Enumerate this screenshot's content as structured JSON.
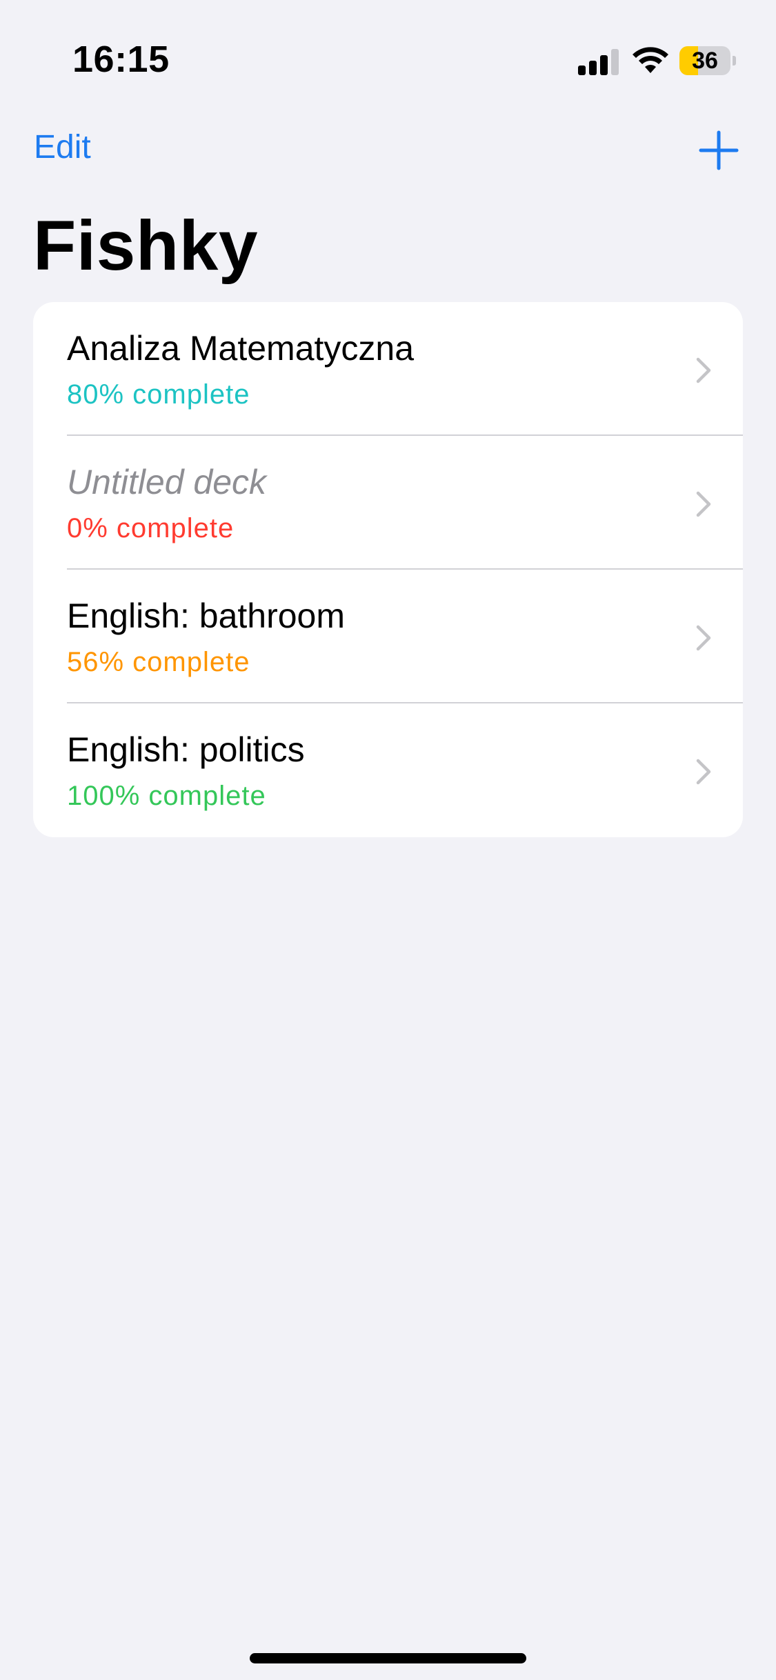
{
  "status_bar": {
    "time": "16:15",
    "battery_level": "36",
    "battery_color": "#ffcc00",
    "signal_bars_active": 3,
    "signal_bars_total": 4
  },
  "nav": {
    "edit_label": "Edit",
    "add_icon": "plus-icon",
    "accent_color": "#1d7bf0"
  },
  "page": {
    "title": "Fishky"
  },
  "decks": [
    {
      "title": "Analiza Matematyczna",
      "progress": "80% complete",
      "progress_color": "#1cc3c3",
      "placeholder": false
    },
    {
      "title": "Untitled deck",
      "progress": "0% complete",
      "progress_color": "#ff3b30",
      "placeholder": true
    },
    {
      "title": "English: bathroom",
      "progress": "56% complete",
      "progress_color": "#ff9500",
      "placeholder": false
    },
    {
      "title": "English: politics",
      "progress": "100% complete",
      "progress_color": "#34c759",
      "placeholder": false
    }
  ]
}
